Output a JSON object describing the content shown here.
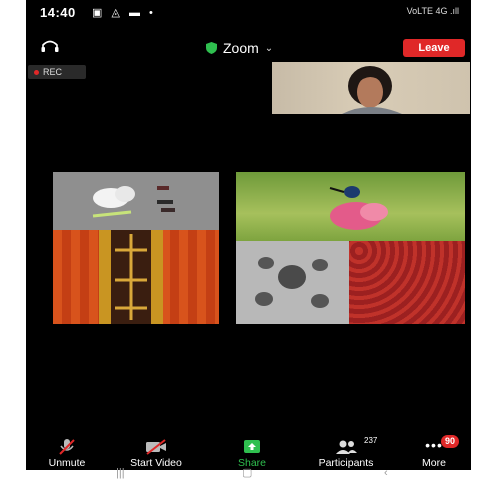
{
  "status_bar": {
    "time": "14:40",
    "network": "VoLTE 4G .ıll"
  },
  "top_bar": {
    "title": "Zoom",
    "leave_label": "Leave"
  },
  "recording": {
    "label": "REC"
  },
  "bottom_bar": {
    "unmute_label": "Unmute",
    "start_video_label": "Start Video",
    "share_label": "Share",
    "participants_label": "Participants",
    "participants_count": "237",
    "more_label": "More",
    "more_badge": "90"
  },
  "colors": {
    "leave_red": "#e02828",
    "share_green": "#2fbf4f",
    "shield_green": "#2fbf4f"
  }
}
